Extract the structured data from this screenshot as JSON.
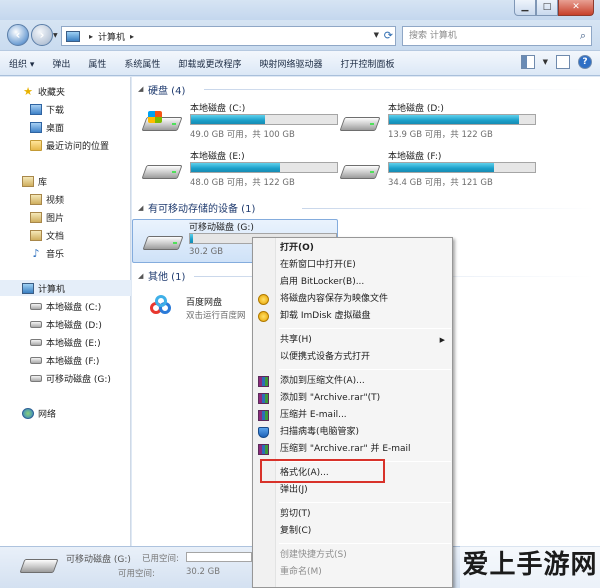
{
  "window": {
    "minimize": "▁",
    "maximize": "□",
    "close": "✕"
  },
  "address": {
    "root_arrow": "▸",
    "location": "计算机",
    "tail_arrow": "▸",
    "search_placeholder": "搜索 计算机"
  },
  "toolbar": {
    "items": [
      "组织 ▾",
      "弹出",
      "属性",
      "系统属性",
      "卸载或更改程序",
      "映射网络驱动器",
      "打开控制面板"
    ],
    "help": "?"
  },
  "nav": {
    "favorites": "收藏夹",
    "downloads": "下载",
    "desktop": "桌面",
    "recent": "最近访问的位置",
    "libraries": "库",
    "videos": "视频",
    "pictures": "图片",
    "documents": "文档",
    "music": "音乐",
    "computer": "计算机",
    "drive_c": "本地磁盘 (C:)",
    "drive_d": "本地磁盘 (D:)",
    "drive_e": "本地磁盘 (E:)",
    "drive_f": "本地磁盘 (F:)",
    "drive_g": "可移动磁盘 (G:)",
    "network": "网络"
  },
  "groups": {
    "hdd": "硬盘 (4)",
    "removable": "有可移动存储的设备 (1)",
    "other": "其他 (1)"
  },
  "drives": [
    {
      "name": "本地磁盘 (C:)",
      "info": "49.0 GB 可用，共 100 GB",
      "used_fraction": 0.51
    },
    {
      "name": "本地磁盘 (D:)",
      "info": "13.9 GB 可用，共 122 GB",
      "used_fraction": 0.89
    },
    {
      "name": "本地磁盘 (E:)",
      "info": "48.0 GB 可用，共 122 GB",
      "used_fraction": 0.61
    },
    {
      "name": "本地磁盘 (F:)",
      "info": "34.4 GB 可用，共 121 GB",
      "used_fraction": 0.72
    }
  ],
  "removable": {
    "name": "可移动磁盘 (G:)",
    "info": "30.2 GB",
    "used_fraction": 0.02
  },
  "other_item": {
    "name": "百度网盘",
    "desc": "双击运行百度网"
  },
  "context_menu": {
    "open": "打开(O)",
    "open_new": "在新窗口中打开(E)",
    "bitlocker": "启用 BitLocker(B)...",
    "save_image": "将磁盘内容保存为映像文件",
    "unmount": "卸载 ImDisk 虚拟磁盘",
    "share": "共享(H)",
    "portable": "以便携式设备方式打开",
    "add_archive": "添加到压缩文件(A)...",
    "add_rar": "添加到 \"Archive.rar\"(T)",
    "compress_email": "压缩并 E-mail...",
    "scan": "扫描病毒(电脑管家)",
    "compress_rar_email": "压缩到 \"Archive.rar\" 并 E-mail",
    "format": "格式化(A)...",
    "eject": "弹出(J)",
    "cut": "剪切(T)",
    "copy": "复制(C)",
    "shortcut": "创建快捷方式(S)",
    "rename": "重命名(M)"
  },
  "status": {
    "name": "可移动磁盘 (G:)",
    "used_label": "已用空间:",
    "free_label": "可用空间:",
    "free_value": "30.2 GB"
  },
  "watermark": "爱上手游网",
  "colors": {
    "accent": "#1b9fc9",
    "highlight_border": "#d8322a"
  }
}
